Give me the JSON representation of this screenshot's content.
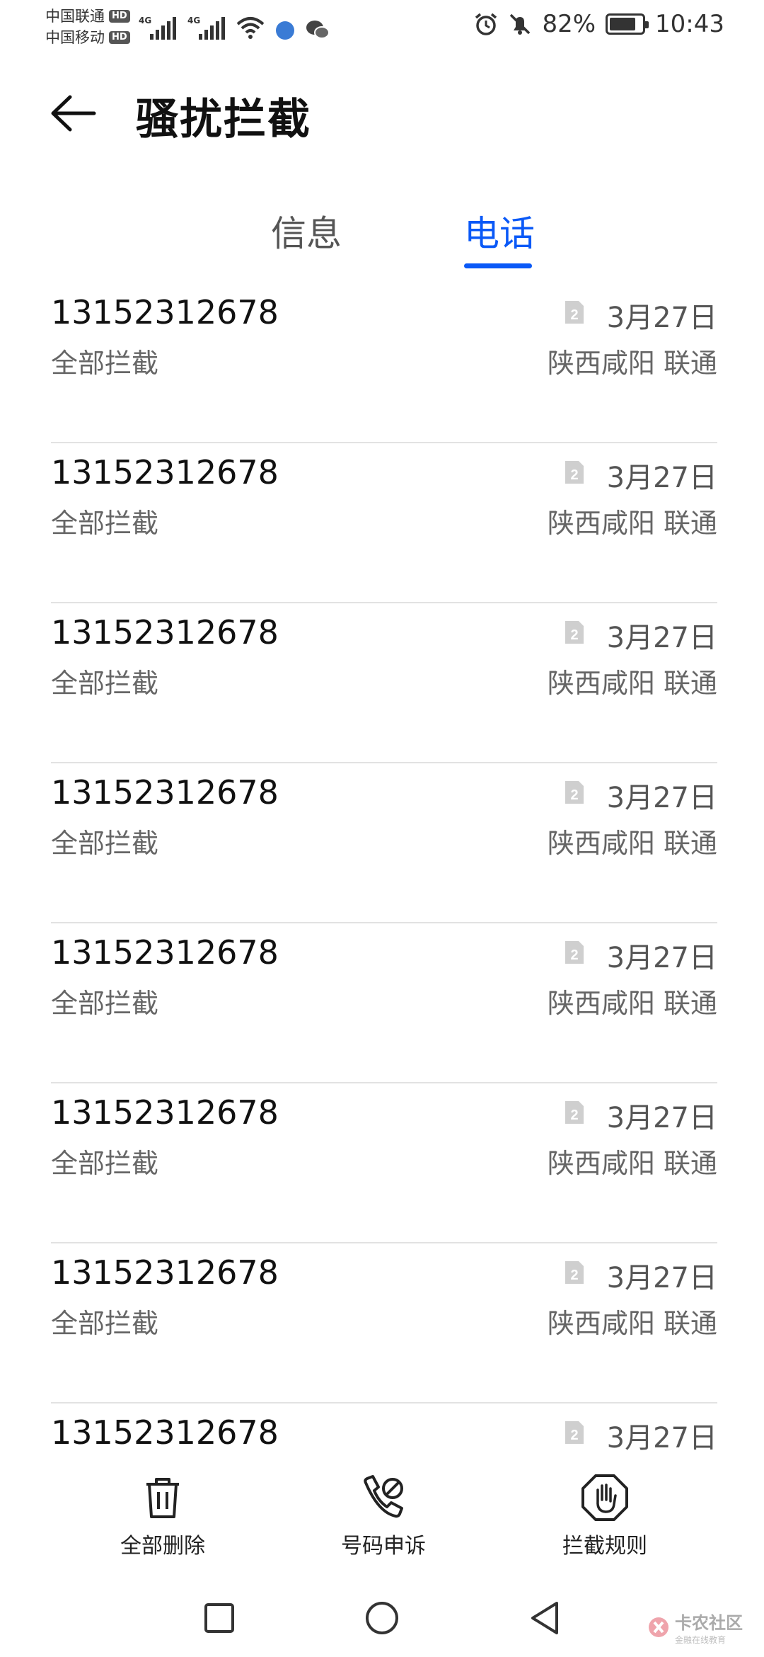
{
  "status_bar": {
    "carrier1": "中国联通",
    "carrier2": "中国移动",
    "hd_badge": "HD",
    "network_gen": "4G",
    "battery": "82%",
    "battery_level": 0.82,
    "time": "10:43"
  },
  "header": {
    "title": "骚扰拦截"
  },
  "tabs": [
    {
      "label": "信息",
      "active": false
    },
    {
      "label": "电话",
      "active": true
    }
  ],
  "accent_color": "#0a59f7",
  "calls": [
    {
      "number": "13152312678",
      "type": "全部拦截",
      "sim": "2",
      "date": "3月27日",
      "location": "陕西咸阳 联通"
    },
    {
      "number": "13152312678",
      "type": "全部拦截",
      "sim": "2",
      "date": "3月27日",
      "location": "陕西咸阳 联通"
    },
    {
      "number": "13152312678",
      "type": "全部拦截",
      "sim": "2",
      "date": "3月27日",
      "location": "陕西咸阳 联通"
    },
    {
      "number": "13152312678",
      "type": "全部拦截",
      "sim": "2",
      "date": "3月27日",
      "location": "陕西咸阳 联通"
    },
    {
      "number": "13152312678",
      "type": "全部拦截",
      "sim": "2",
      "date": "3月27日",
      "location": "陕西咸阳 联通"
    },
    {
      "number": "13152312678",
      "type": "全部拦截",
      "sim": "2",
      "date": "3月27日",
      "location": "陕西咸阳 联通"
    },
    {
      "number": "13152312678",
      "type": "全部拦截",
      "sim": "2",
      "date": "3月27日",
      "location": "陕西咸阳 联通"
    },
    {
      "number": "13152312678",
      "type": "",
      "sim": "2",
      "date": "3月27日",
      "location": ""
    }
  ],
  "toolbar": {
    "delete_all": "全部删除",
    "appeal": "号码申诉",
    "rules": "拦截规则"
  },
  "watermark": {
    "title": "卡农社区",
    "subtitle": "金融在线教育"
  }
}
